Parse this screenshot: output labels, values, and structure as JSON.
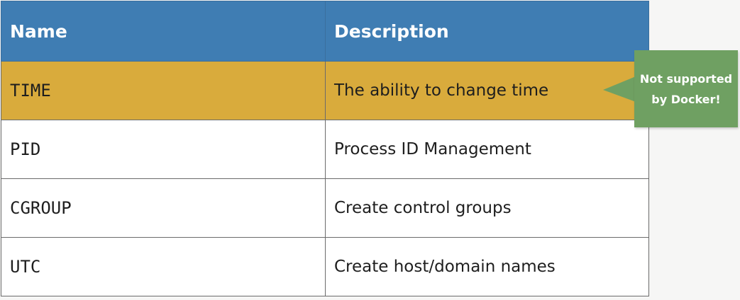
{
  "table": {
    "headers": {
      "name": "Name",
      "description": "Description"
    },
    "rows": [
      {
        "name": "TIME",
        "description": "The ability to change time",
        "highlighted": true
      },
      {
        "name": "PID",
        "description": "Process ID Management",
        "highlighted": false
      },
      {
        "name": "CGROUP",
        "description": "Create control groups",
        "highlighted": false
      },
      {
        "name": "UTC",
        "description": "Create host/domain names",
        "highlighted": false
      }
    ]
  },
  "callout": {
    "line1": "Not supported",
    "line2": "by Docker!"
  },
  "colors": {
    "header_background": "#3f7db3",
    "highlight_row": "#d9ab3c",
    "callout_background": "#6fa062",
    "page_background": "#f6f6f5"
  }
}
